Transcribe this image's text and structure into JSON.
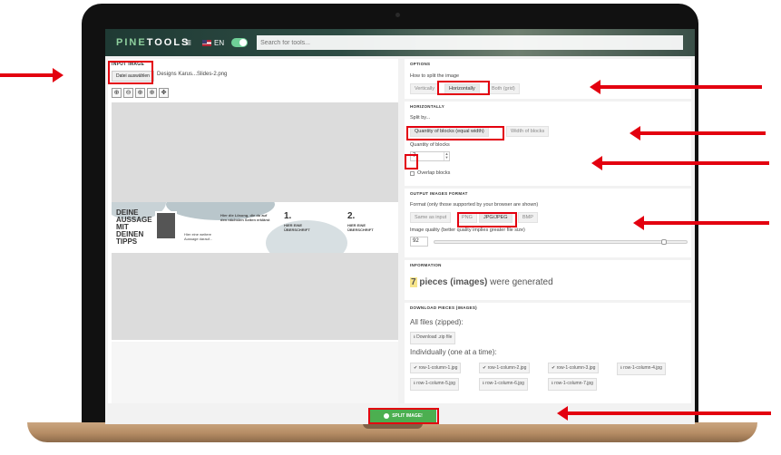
{
  "topbar": {
    "logo_main": "PINE",
    "logo_accent": "TOOLS",
    "menu_icon": "hamburger-icon",
    "language": "EN",
    "search_placeholder": "Search for tools..."
  },
  "input_image": {
    "title": "INPUT IMAGE",
    "file_button": "Datei auswählen",
    "file_name": "Designs Karus...Slides-2.png",
    "zoom_tools": [
      "zoom-in-icon",
      "zoom-out-icon",
      "zoom-fit-icon",
      "zoom-reset-icon",
      "move-icon"
    ],
    "banner": {
      "headline": [
        "DEINE",
        "AUSSAGE",
        "MIT",
        "DEINEN",
        "TIPPS"
      ],
      "text1": "Hier die Lösung, die du auf den nächsten Seiten erklärst",
      "text2": "Hier eine weitere Aussage darauf...",
      "step1_num": "1.",
      "step1_title": "HIER EINE ÜBERSCHRIFT",
      "step2_num": "2.",
      "step2_title": "HIER EINE ÜBERSCHRIFT"
    }
  },
  "options": {
    "title": "OPTIONS",
    "how_label": "How to split the image",
    "modes": [
      "Vertically",
      "Horizontally",
      "Both (grid)"
    ],
    "selected_mode": "Horizontally"
  },
  "horizontally": {
    "title": "HORIZONTALLY",
    "split_by_label": "Split by...",
    "split_by_options": [
      "Quantity of blocks (equal width)",
      "Width of blocks"
    ],
    "selected_split": "Quantity of blocks (equal width)",
    "quantity_label": "Quantity of blocks",
    "quantity_value": "7",
    "overlap_label": "Overlap blocks"
  },
  "output_format": {
    "title": "OUTPUT IMAGES FORMAT",
    "format_label": "Format (only those supported by your browser are shown)",
    "formats": [
      "Same as input",
      "PNG",
      "JPG/JPEG",
      "BMP"
    ],
    "selected_format": "JPG/JPEG",
    "quality_label": "Image quality (better quality implies greater file size)",
    "quality_value": "92",
    "quality_fraction": 0.92
  },
  "information": {
    "title": "INFORMATION",
    "count": "7",
    "pieces_text": "pieces (images)",
    "suffix_text": "were generated"
  },
  "download": {
    "title": "DOWNLOAD PIECES (IMAGES)",
    "all_files_label": "All files (zipped):",
    "zip_button": "Download .zip file",
    "individual_label": "Individually (one at a time):",
    "files": [
      {
        "name": "row-1-column-1.jpg",
        "icon": "check-icon"
      },
      {
        "name": "row-1-column-2.jpg",
        "icon": "check-icon"
      },
      {
        "name": "row-1-column-3.jpg",
        "icon": "check-icon"
      },
      {
        "name": "row-1-column-4.jpg",
        "icon": "download-icon"
      },
      {
        "name": "row-1-column-5.jpg",
        "icon": "download-icon"
      },
      {
        "name": "row-1-column-6.jpg",
        "icon": "download-icon"
      },
      {
        "name": "row-1-column-7.jpg",
        "icon": "download-icon"
      }
    ]
  },
  "split_button": "SPLIT IMAGE!",
  "colors": {
    "accent_green": "#4caf50",
    "annotation_red": "#e3000f",
    "highlight_yellow": "#f7e58b"
  }
}
